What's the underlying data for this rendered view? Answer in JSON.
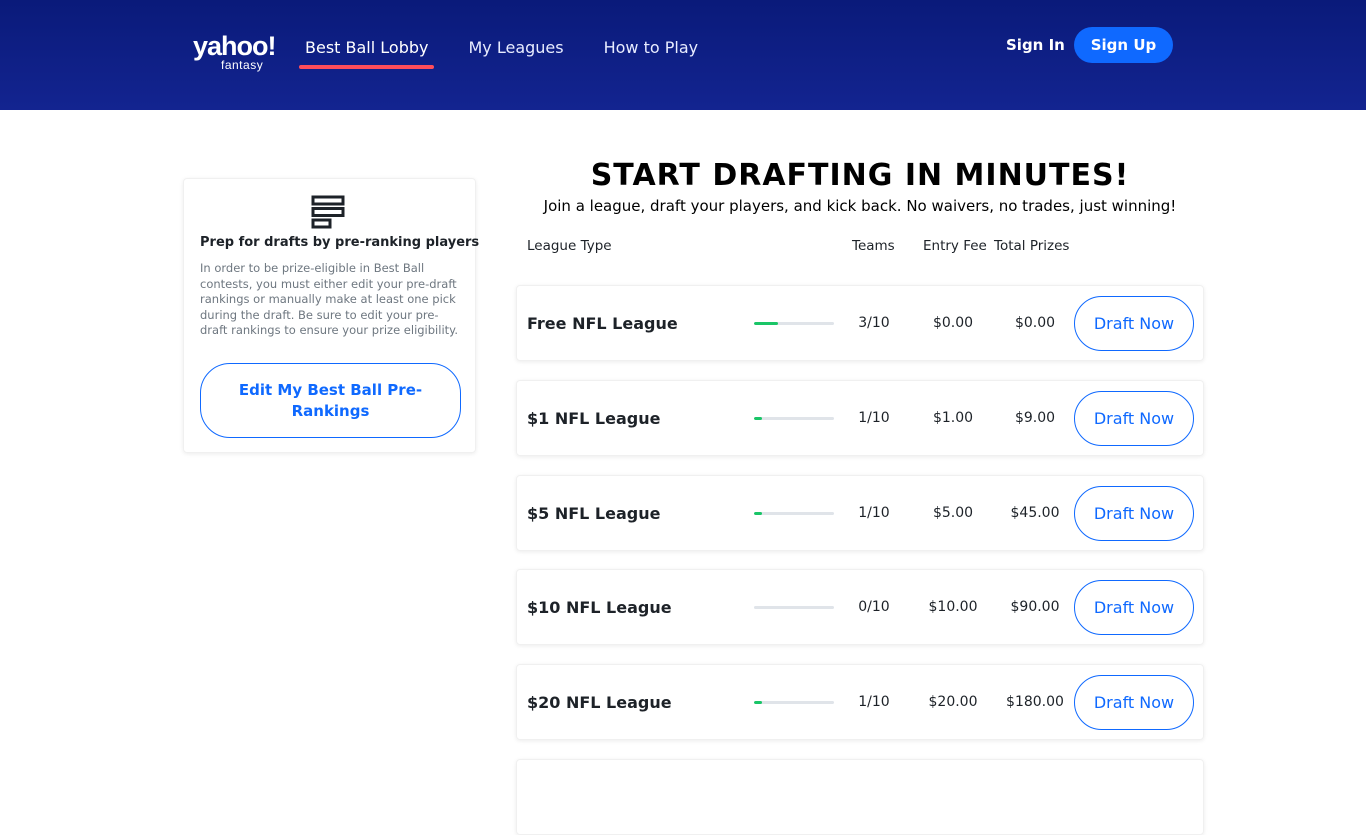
{
  "header": {
    "logo_main": "yahoo!",
    "logo_sub": "fantasy",
    "nav": [
      "Best Ball Lobby",
      "My Leagues",
      "How to Play"
    ],
    "sign_in": "Sign In",
    "sign_up": "Sign Up"
  },
  "prep_card": {
    "title": "Prep for drafts by pre-ranking players",
    "description": "In order to be prize-eligible in Best Ball contests, you must either edit your pre-draft rankings or manually make at least one pick during the draft. Be sure to edit your pre-draft rankings to ensure your prize eligibility.",
    "button_label": "Edit My Best Ball Pre-Rankings"
  },
  "main": {
    "title": "START DRAFTING IN MINUTES!",
    "subtitle": "Join a league, draft your players, and kick back. No waivers, no trades, just winning!",
    "columns": {
      "league_type": "League Type",
      "teams": "Teams",
      "entry_fee": "Entry Fee",
      "total_prizes": "Total Prizes"
    },
    "leagues": [
      {
        "name": "Free NFL League",
        "teams": "3/10",
        "fill": 0.3,
        "entry_fee": "$0.00",
        "total_prizes": "$0.00",
        "action": "Draft Now"
      },
      {
        "name": "$1 NFL League",
        "teams": "1/10",
        "fill": 0.1,
        "entry_fee": "$1.00",
        "total_prizes": "$9.00",
        "action": "Draft Now"
      },
      {
        "name": "$5 NFL League",
        "teams": "1/10",
        "fill": 0.1,
        "entry_fee": "$5.00",
        "total_prizes": "$45.00",
        "action": "Draft Now"
      },
      {
        "name": "$10 NFL League",
        "teams": "0/10",
        "fill": 0.0,
        "entry_fee": "$10.00",
        "total_prizes": "$90.00",
        "action": "Draft Now"
      },
      {
        "name": "$20 NFL League",
        "teams": "1/10",
        "fill": 0.1,
        "entry_fee": "$20.00",
        "total_prizes": "$180.00",
        "action": "Draft Now"
      }
    ]
  },
  "colors": {
    "header_bg": "#0e1e80",
    "accent_blue": "#0f69ff",
    "nav_underline": "#ff4d5a",
    "progress_green": "#1ac567"
  },
  "icons": {
    "prep_icon": "list-icon"
  }
}
